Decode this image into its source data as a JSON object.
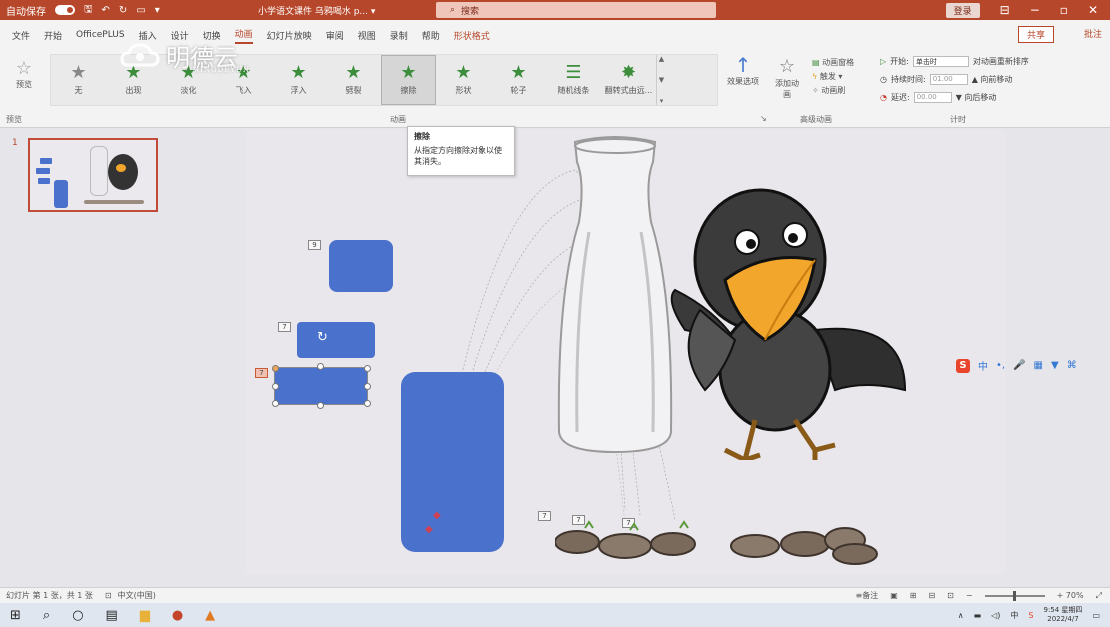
{
  "titlebar": {
    "autosave": "自动保存",
    "autosave_state": "关",
    "doc_title": "小学语文课件 乌鸦喝水 p... ▾",
    "search": "搜索",
    "login": "登录"
  },
  "menu": {
    "tabs": [
      "文件",
      "开始",
      "OfficePLUS",
      "插入",
      "设计",
      "切换",
      "动画",
      "幻灯片放映",
      "审阅",
      "视图",
      "录制",
      "帮助",
      "形状格式"
    ],
    "active_tab": "动画",
    "share": "共享",
    "comment": "批注"
  },
  "ribbon": {
    "preview_label": "预览",
    "preview_group": "预览",
    "animation_group": "动画",
    "advanced_group": "高级动画",
    "timing_group": "计时",
    "animations": [
      {
        "label": "无",
        "style": "gray"
      },
      {
        "label": "出现",
        "style": "green"
      },
      {
        "label": "淡化",
        "style": "green"
      },
      {
        "label": "飞入",
        "style": "green"
      },
      {
        "label": "浮入",
        "style": "green"
      },
      {
        "label": "劈裂",
        "style": "green"
      },
      {
        "label": "擦除",
        "style": "selected"
      },
      {
        "label": "形状",
        "style": "green"
      },
      {
        "label": "轮子",
        "style": "green"
      },
      {
        "label": "随机线条",
        "style": "green"
      },
      {
        "label": "翻转式由远...",
        "style": "green"
      }
    ],
    "effect_options": "效果选项",
    "add_animation": "添加动画",
    "animation_pane": "动画窗格",
    "trigger": "触发",
    "animation_painter": "动画刷",
    "start_label": "开始:",
    "start_value": "单击时",
    "duration_label": "持续时间:",
    "duration_value": "01.00",
    "delay_label": "延迟:",
    "delay_value": "00.00",
    "reorder": "对动画重新排序",
    "move_earlier": "向前移动",
    "move_later": "向后移动"
  },
  "thumbnail": {
    "slide_number": "1"
  },
  "tooltip": {
    "title": "擦除",
    "body": "从指定方向擦除对象以使其消失。"
  },
  "tags": [
    "9",
    "7",
    "7",
    "7",
    "7",
    "7"
  ],
  "ime": {
    "label": "中"
  },
  "status": {
    "slide_info": "幻灯片 第 1 张，共 1 张",
    "language": "中文(中国)",
    "notes": "备注",
    "zoom": "+ 70% "
  },
  "taskbar": {
    "time": "9:54 星期四",
    "date": "2022/4/7"
  },
  "watermark": {
    "brand": "明德云",
    "sub": "MINGDEYUN"
  }
}
